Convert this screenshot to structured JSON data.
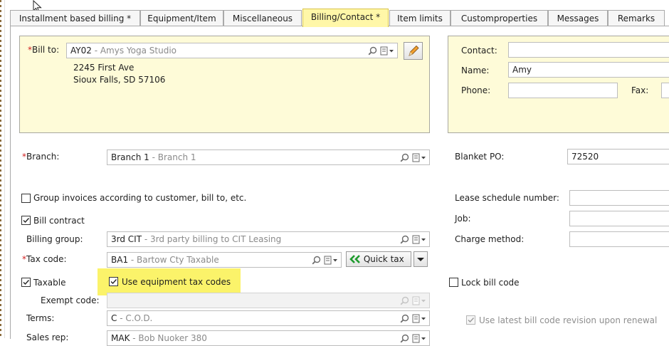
{
  "tabs": [
    {
      "label": "Installment based billing *"
    },
    {
      "label": "Equipment/Item"
    },
    {
      "label": "Miscellaneous"
    },
    {
      "label": "Billing/Contact *"
    },
    {
      "label": "Item limits"
    },
    {
      "label": "Customproperties"
    },
    {
      "label": "Messages"
    },
    {
      "label": "Remarks"
    }
  ],
  "bill_to": {
    "label": "Bill to:",
    "required_mark": "*",
    "code": "AY02",
    "desc": " - Amys Yoga Studio",
    "address_line1": "2245 First Ave",
    "address_line2": "Sioux Falls, SD 57106"
  },
  "contact": {
    "contact_label": "Contact:",
    "contact_value": "",
    "name_label": "Name:",
    "name_value": "Amy",
    "phone_label": "Phone:",
    "phone_value": "",
    "fax_label": "Fax:",
    "fax_value": ""
  },
  "branch": {
    "label": "Branch:",
    "required_mark": "*",
    "code": "Branch 1",
    "desc": " - Branch 1"
  },
  "blanket_po": {
    "label": "Blanket PO:",
    "value": "72520"
  },
  "group_invoices": {
    "label": "Group invoices according to customer, bill to, etc.",
    "checked": false
  },
  "lease_schedule": {
    "label": "Lease schedule number:",
    "value": ""
  },
  "bill_contract": {
    "label": "Bill contract",
    "checked": true
  },
  "job": {
    "label": "Job:",
    "value": ""
  },
  "billing_group": {
    "label": "Billing group:",
    "code": "3rd CIT",
    "desc": " - 3rd party billing to CIT Leasing"
  },
  "charge_method": {
    "label": "Charge method:",
    "value": ""
  },
  "tax_code": {
    "label": "Tax code:",
    "required_mark": "*",
    "code": "BA1",
    "desc": " - Bartow Cty Taxable"
  },
  "quick_tax": {
    "label": "Quick tax"
  },
  "taxable": {
    "label": "Taxable",
    "checked": true
  },
  "use_equipment_tax": {
    "label": "Use equipment tax codes",
    "checked": true
  },
  "lock_bill_code": {
    "label": "Lock bill code",
    "checked": false
  },
  "exempt_code": {
    "label": "Exempt code:",
    "value": ""
  },
  "terms": {
    "label": "Terms:",
    "code": "C",
    "desc": " - C.O.D."
  },
  "use_latest_bill_code": {
    "label": "Use latest bill code revision upon renewal",
    "checked": true
  },
  "sales_rep": {
    "label": "Sales rep:",
    "code": "MAK",
    "desc": " - Bob Nuoker 380"
  },
  "colors": {
    "accent": "#fff7a8",
    "highlight": "#fbf36a",
    "panel": "#fefbd8",
    "required": "#d21f1f"
  }
}
